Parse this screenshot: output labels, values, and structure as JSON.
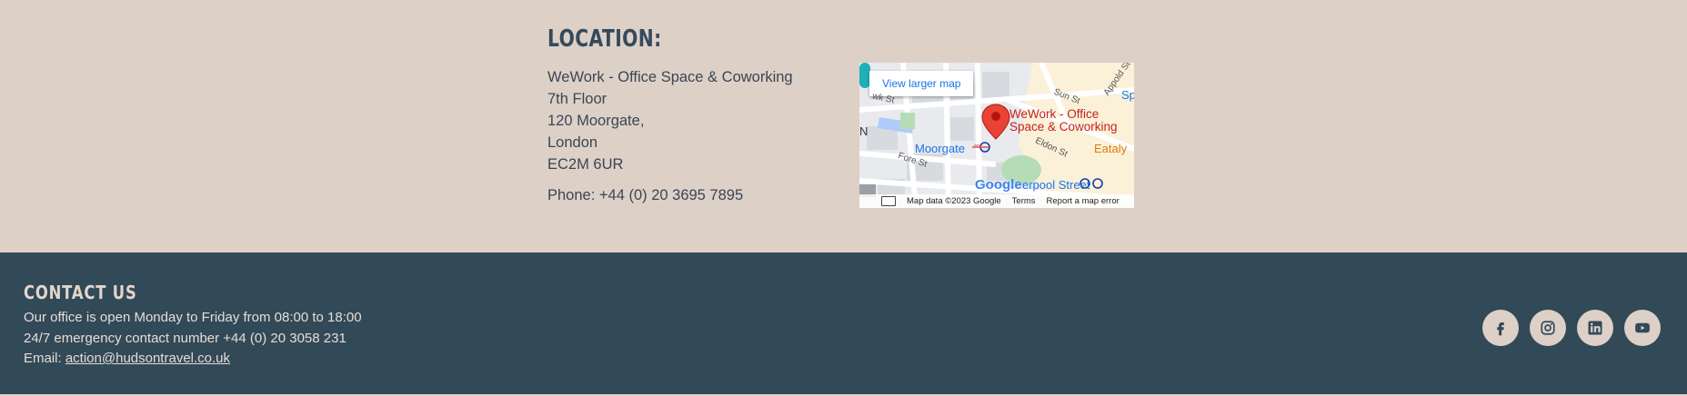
{
  "location": {
    "title": "LOCATION:",
    "address_lines": [
      "WeWork - Office Space & Coworking",
      "7th Floor",
      "120 Moorgate,",
      "London",
      "EC2M 6UR"
    ],
    "phone": "Phone: +44 (0) 20 3695 7895"
  },
  "map": {
    "view_larger": "View larger map",
    "place_name_line1": "WeWork - Office",
    "place_name_line2": "Space & Coworking",
    "moorgate": "Moorgate",
    "eataly": "Eataly",
    "liverpool": "erpool Street",
    "google": "Google",
    "streets": {
      "sun_st": "Sun St",
      "appold_st": "Appold St",
      "eldon_st": "Eldon St",
      "fore_st": "Fore St",
      "wk_st": "wk St"
    },
    "edge_letters": {
      "sp": "Sp",
      "n": "N"
    },
    "map_data": "Map data ©2023 Google",
    "terms": "Terms",
    "report": "Report a map error"
  },
  "contact": {
    "title": "CONTACT US",
    "hours": "Our office is open Monday to Friday from 08:00 to 18:00",
    "emergency": "24/7 emergency contact number +44 (0) 20 3058 231",
    "email_prefix": "Email: ",
    "email": "action@hudsontravel.co.uk"
  },
  "socials": [
    {
      "name": "facebook-icon"
    },
    {
      "name": "instagram-icon"
    },
    {
      "name": "linkedin-icon"
    },
    {
      "name": "youtube-icon"
    }
  ],
  "colors": {
    "background": "#ddd0c7",
    "footer": "#324958",
    "heading": "#344a5c",
    "social_circle": "#ddd0c7"
  }
}
